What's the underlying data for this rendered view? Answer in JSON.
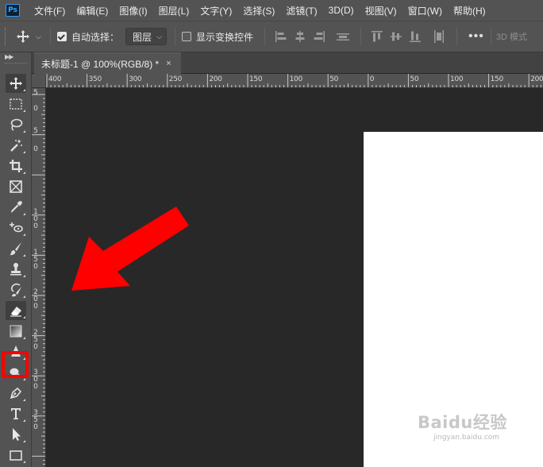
{
  "app": {
    "logo_text": "Ps"
  },
  "menu": {
    "items": [
      {
        "label": "文件(F)"
      },
      {
        "label": "编辑(E)"
      },
      {
        "label": "图像(I)"
      },
      {
        "label": "图层(L)"
      },
      {
        "label": "文字(Y)"
      },
      {
        "label": "选择(S)"
      },
      {
        "label": "滤镜(T)"
      },
      {
        "label": "3D(D)"
      },
      {
        "label": "视图(V)"
      },
      {
        "label": "窗口(W)"
      },
      {
        "label": "帮助(H)"
      }
    ]
  },
  "options": {
    "auto_select_label": "自动选择：",
    "auto_select_checked": true,
    "auto_select_target": "图层",
    "show_transform_label": "显示变换控件",
    "show_transform_checked": false,
    "more_label": "•••",
    "mode_3d_label": "3D 模式"
  },
  "document": {
    "tab_title": "未标题-1 @ 100%(RGB/8) *",
    "close_symbol": "×"
  },
  "rulers": {
    "horizontal_labels": [
      "400",
      "350",
      "300",
      "250",
      "200",
      "150",
      "100",
      "50",
      "0",
      "50",
      "100",
      "150",
      "200"
    ],
    "vertical_labels": [
      "5",
      "0",
      "5",
      "0",
      "1 0 0",
      "1 5 0",
      "2 0 0",
      "2 5 0",
      "3 0 0",
      "3 5 0"
    ]
  },
  "toolbar": {
    "tools": [
      {
        "name": "move-tool",
        "icon": "move-icon"
      },
      {
        "name": "marquee-tool",
        "icon": "rectangle-marquee-icon"
      },
      {
        "name": "lasso-tool",
        "icon": "lasso-icon"
      },
      {
        "name": "magic-wand-tool",
        "icon": "magic-wand-icon"
      },
      {
        "name": "crop-tool",
        "icon": "crop-icon"
      },
      {
        "name": "frame-tool",
        "icon": "frame-icon"
      },
      {
        "name": "eyedropper-tool",
        "icon": "eyedropper-icon"
      },
      {
        "name": "spot-healing-tool",
        "icon": "healing-brush-icon"
      },
      {
        "name": "brush-tool",
        "icon": "brush-icon"
      },
      {
        "name": "clone-stamp-tool",
        "icon": "stamp-icon"
      },
      {
        "name": "history-brush-tool",
        "icon": "history-brush-icon"
      },
      {
        "name": "eraser-tool",
        "icon": "eraser-icon",
        "highlighted": true
      },
      {
        "name": "gradient-tool",
        "icon": "gradient-icon"
      },
      {
        "name": "blur-tool",
        "icon": "blur-icon"
      },
      {
        "name": "dodge-tool",
        "icon": "dodge-icon"
      },
      {
        "name": "pen-tool",
        "icon": "pen-icon"
      },
      {
        "name": "type-tool",
        "icon": "type-icon"
      },
      {
        "name": "path-selection-tool",
        "icon": "path-selection-icon"
      },
      {
        "name": "shape-tool",
        "icon": "rectangle-shape-icon"
      }
    ]
  },
  "annotation": {
    "arrow_color": "#ff0000",
    "highlight_color": "#ff0000"
  },
  "watermark": {
    "main": "Baidu经验",
    "sub": "jingyan.baidu.com"
  },
  "colors": {
    "panel": "#535353",
    "workspace": "#282828",
    "canvas": "#ffffff",
    "ps_blue": "#31a8ff"
  }
}
